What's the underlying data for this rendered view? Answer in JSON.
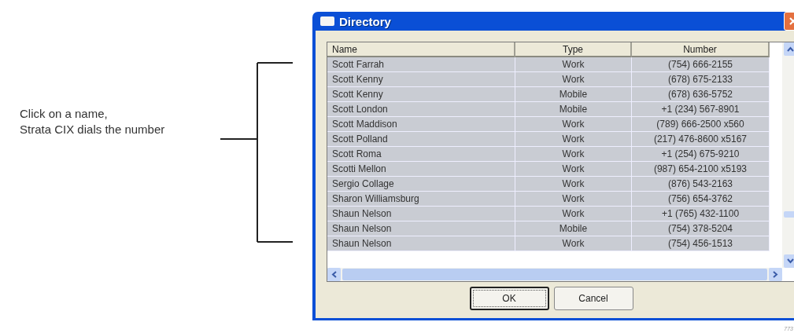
{
  "callout": {
    "lines": [
      "Click on a name,",
      "Strata CIX dials the number"
    ]
  },
  "window": {
    "title": "Directory"
  },
  "table": {
    "columns": [
      "Name",
      "Type",
      "Number"
    ],
    "rows": [
      {
        "name": "Scott Farrah",
        "type": "Work",
        "number": "(754) 666-2155"
      },
      {
        "name": "Scott Kenny",
        "type": "Work",
        "number": "(678) 675-2133"
      },
      {
        "name": "Scott Kenny",
        "type": "Mobile",
        "number": "(678) 636-5752"
      },
      {
        "name": "Scott London",
        "type": "Mobile",
        "number": "+1 (234) 567-8901"
      },
      {
        "name": "Scott Maddison",
        "type": "Work",
        "number": "(789) 666-2500 x560"
      },
      {
        "name": "Scott Polland",
        "type": "Work",
        "number": "(217) 476-8600 x5167"
      },
      {
        "name": "Scott Roma",
        "type": "Work",
        "number": "+1 (254) 675-9210"
      },
      {
        "name": "Scotti Mellon",
        "type": "Work",
        "number": "(987) 654-2100 x5193"
      },
      {
        "name": "Sergio Collage",
        "type": "Work",
        "number": "(876) 543-2163"
      },
      {
        "name": "Sharon Williamsburg",
        "type": "Work",
        "number": "(756) 654-3762"
      },
      {
        "name": "Shaun Nelson",
        "type": "Work",
        "number": "+1 (765) 432-1100"
      },
      {
        "name": "Shaun Nelson",
        "type": "Mobile",
        "number": "(754) 378-5204"
      },
      {
        "name": "Shaun Nelson",
        "type": "Work",
        "number": "(754) 456-1513"
      }
    ]
  },
  "buttons": [
    {
      "label": "OK",
      "default": true
    },
    {
      "label": "Cancel",
      "default": false
    }
  ],
  "figure_number": "773"
}
